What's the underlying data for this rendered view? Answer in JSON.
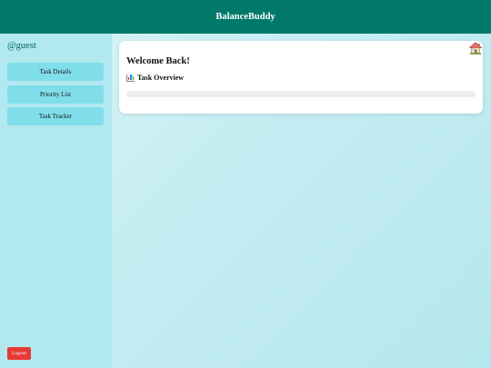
{
  "header": {
    "title": "BalanceBuddy"
  },
  "sidebar": {
    "username": "@guest",
    "items": [
      {
        "label": "Task Details"
      },
      {
        "label": "Priority List"
      },
      {
        "label": "Task Tracker"
      }
    ],
    "logout_label": "Logout"
  },
  "main": {
    "welcome_title": "Welcome Back!",
    "overview_title": "Task Overview",
    "overview_icon": "bar-chart-icon",
    "progress_fraction": 0
  },
  "home_icon": "home-icon",
  "colors": {
    "header": "#00796b",
    "sidebar": "#b2e8ef",
    "nav_button": "#80deea",
    "logout": "#e53935",
    "username": "#00695c"
  }
}
